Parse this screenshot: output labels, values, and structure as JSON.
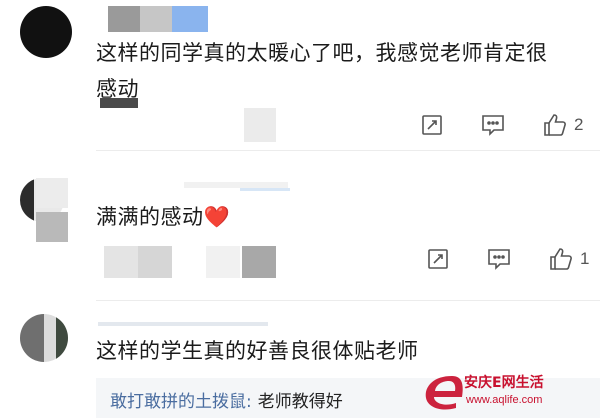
{
  "comments": [
    {
      "text_line1": "这样的同学真的太暖心了吧，我感觉老师肯定很",
      "text_line2": "感动",
      "like_count": "2"
    },
    {
      "text": "满满的感动",
      "emoji": "❤️",
      "like_count": "1"
    },
    {
      "text": "这样的学生真的好善良很体贴老师",
      "reply": {
        "user": "敢打敢拼的土拨鼠",
        "separator": ":",
        "text": "老师教得好"
      }
    }
  ],
  "watermark": {
    "brand": "安庆E网生活",
    "url": "www.aqlife.com",
    "accent": "#c8102e"
  },
  "icons": [
    "edit-icon",
    "comment-icon",
    "like-icon"
  ]
}
